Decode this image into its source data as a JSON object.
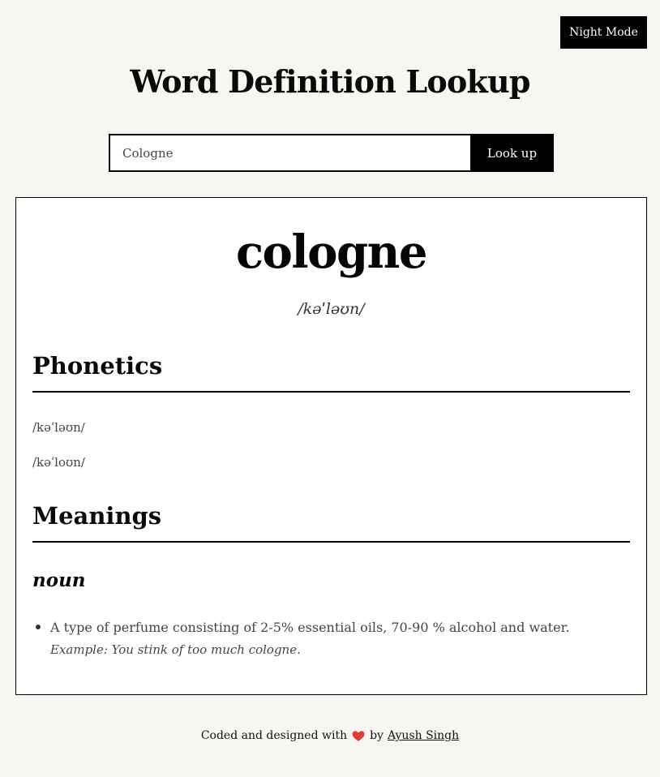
{
  "header": {
    "night_mode_label": "Night Mode",
    "title": "Word Definition Lookup"
  },
  "search": {
    "value": "Cologne",
    "button_label": "Look up"
  },
  "result": {
    "word": "cologne",
    "phonetic": "/kəˈləʊn/",
    "phonetics_heading": "Phonetics",
    "phonetics": [
      "/kəˈləʊn/",
      "/kəˈloʊn/"
    ],
    "meanings_heading": "Meanings",
    "meanings": [
      {
        "part_of_speech": "noun",
        "definitions": [
          {
            "definition": "A type of perfume consisting of 2-5% essential oils, 70-90 % alcohol and water.",
            "example": "Example: You stink of too much cologne."
          }
        ]
      }
    ]
  },
  "footer": {
    "prefix": "Coded and designed with",
    "heart_icon": "heart-icon",
    "by": "by",
    "author": "Ayush Singh",
    "heart_color": "#e53935"
  }
}
